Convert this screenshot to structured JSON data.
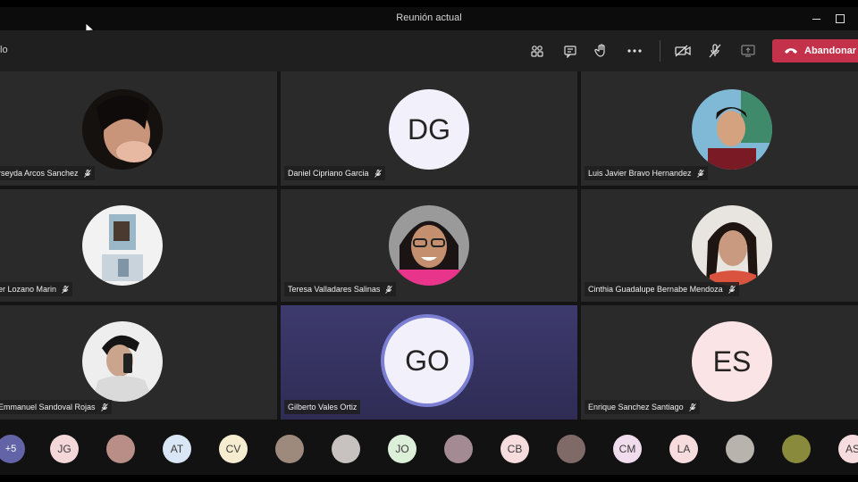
{
  "window": {
    "title": "Reunión actual"
  },
  "toolbar": {
    "leave_label": "Abandonar",
    "timer_fragment": "lo"
  },
  "tiles": [
    {
      "name": "Nerseyda Arcos Sanchez",
      "display": "rseyda Arcos Sanchez",
      "type": "photo"
    },
    {
      "name": "Daniel Cipriano Garcia",
      "display": "Daniel Cipriano Garcia",
      "initials": "DG",
      "type": "initials"
    },
    {
      "name": "Luis Javier Bravo Hernandez",
      "display": "Luis Javier Bravo Hernandez",
      "type": "photo"
    },
    {
      "name": "Lozano Marin",
      "display": "er Lozano Marin",
      "type": "photo"
    },
    {
      "name": "Teresa Valladares Salinas",
      "display": "Teresa Valladares Salinas",
      "type": "photo"
    },
    {
      "name": "Cinthia Guadalupe Bernabe Mendoza",
      "display": "Cinthia Guadalupe Bernabe Mendoza",
      "type": "photo"
    },
    {
      "name": "Emmanuel Sandoval Rojas",
      "display": "Emmanuel Sandoval Rojas",
      "type": "photo"
    },
    {
      "name": "Gilberto Vales Ortiz",
      "display": "Gilberto Vales Ortiz",
      "initials": "GO",
      "type": "initials",
      "speaking": true
    },
    {
      "name": "Enrique Sanchez Santiago",
      "display": "Enrique Sanchez Santiago",
      "initials": "ES",
      "type": "initials"
    }
  ],
  "participants_strip": {
    "more_label": "+5",
    "items": [
      "JG",
      "",
      "AT",
      "CV",
      "",
      "",
      "JO",
      "",
      "CB",
      "",
      "CM",
      "LA",
      "",
      "",
      "AS"
    ]
  },
  "colors": {
    "leave": "#c4314b",
    "accent": "#6264a7",
    "tile": "#2a2a2a"
  }
}
